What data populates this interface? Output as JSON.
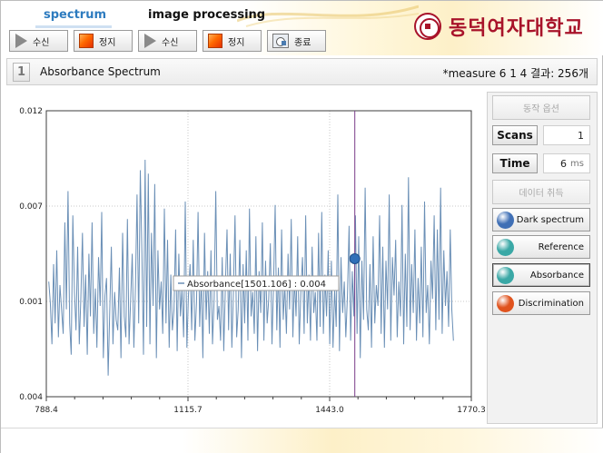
{
  "header": {
    "tabs": [
      "spectrum",
      "image processing"
    ],
    "toolbar": [
      {
        "label": "수신",
        "icon": "play-icon"
      },
      {
        "label": "정지",
        "icon": "stop-icon"
      },
      {
        "label": "수신",
        "icon": "play-icon"
      },
      {
        "label": "정지",
        "icon": "stop-icon"
      },
      {
        "label": "종료",
        "icon": "exit-icon"
      }
    ],
    "logo_text": "동덕여자대학교"
  },
  "titlebar": {
    "number": "1",
    "title": "Absorbance Spectrum",
    "measure": "*measure 6 1 4 결과: 256개"
  },
  "panel": {
    "options_label": "동작 옵션",
    "scans_label": "Scans",
    "scans_value": "1",
    "time_label": "Time",
    "time_value": "6",
    "time_unit": "ms",
    "cancel_label": "데이터 취득",
    "controls": [
      {
        "label": "Dark spectrum",
        "color": "#3f6fb5",
        "selected": false
      },
      {
        "label": "Reference",
        "color": "#3aa8a6",
        "selected": false
      },
      {
        "label": "Absorbance",
        "color": "#3aa8a6",
        "selected": true
      },
      {
        "label": "Discrimination",
        "color": "#e0531e",
        "selected": false
      }
    ]
  },
  "chart_data": {
    "type": "line",
    "xlim": [
      788.4,
      1770.3
    ],
    "ylim": [
      0.004,
      0.012
    ],
    "x_ticks": [
      "788.4",
      "1115.7",
      "1443.0",
      "1770.3"
    ],
    "y_ticks": [
      "0.012",
      "0.007",
      "0.001",
      "0.004"
    ],
    "line_color": "#6a8fb6",
    "cursor_x": 1501.106,
    "cursor_y": 0.004,
    "tooltip": "Absorbance[1501.106] : 0.004",
    "series": [
      {
        "name": "Absorbance",
        "x_start": 794,
        "x_end": 1729,
        "values": [
          0.0053,
          0.0047,
          0.0035,
          0.0058,
          0.0041,
          0.0062,
          0.0037,
          0.0052,
          0.0045,
          0.0038,
          0.007,
          0.0045,
          0.0079,
          0.0041,
          0.0032,
          0.0072,
          0.005,
          0.0039,
          0.0063,
          0.0035,
          0.0048,
          0.0067,
          0.004,
          0.0055,
          0.0032,
          0.0061,
          0.0043,
          0.007,
          0.0038,
          0.0051,
          0.0034,
          0.006,
          0.0046,
          0.0073,
          0.0031,
          0.0049,
          0.0054,
          0.0026,
          0.0045,
          0.0063,
          0.0035,
          0.005,
          0.0042,
          0.0039,
          0.0057,
          0.0031,
          0.0067,
          0.0043,
          0.0037,
          0.0071,
          0.0035,
          0.0048,
          0.0061,
          0.0034,
          0.0052,
          0.0078,
          0.0041,
          0.0085,
          0.0062,
          0.0032,
          0.0088,
          0.004,
          0.0084,
          0.0035,
          0.0067,
          0.0046,
          0.0081,
          0.0031,
          0.0062,
          0.0045,
          0.0053,
          0.0038,
          0.0074,
          0.0041,
          0.0065,
          0.0034,
          0.0055,
          0.0039,
          0.0045,
          0.0068,
          0.0033,
          0.0061,
          0.0043,
          0.0051,
          0.0037,
          0.0076,
          0.0034,
          0.0049,
          0.0058,
          0.0039,
          0.0065,
          0.0036,
          0.0047,
          0.0073,
          0.004,
          0.0054,
          0.0031,
          0.0067,
          0.0042,
          0.0056,
          0.0038,
          0.0062,
          0.0035,
          0.0048,
          0.0079,
          0.0042,
          0.0046,
          0.0036,
          0.006,
          0.0033,
          0.0052,
          0.0068,
          0.0039,
          0.0061,
          0.0034,
          0.005,
          0.0072,
          0.0037,
          0.0045,
          0.0065,
          0.0031,
          0.0058,
          0.0041,
          0.0062,
          0.0036,
          0.0074,
          0.0043,
          0.005,
          0.0038,
          0.0066,
          0.0033,
          0.0056,
          0.0044,
          0.007,
          0.0036,
          0.0059,
          0.0041,
          0.0048,
          0.0064,
          0.0035,
          0.0053,
          0.0075,
          0.0039,
          0.0057,
          0.0034,
          0.0068,
          0.0042,
          0.0052,
          0.0038,
          0.0061,
          0.0045,
          0.0071,
          0.0037,
          0.0054,
          0.0043,
          0.0066,
          0.0035,
          0.005,
          0.006,
          0.0038,
          0.0072,
          0.0041,
          0.0055,
          0.0036,
          0.0063,
          0.0044,
          0.005,
          0.0036,
          0.0067,
          0.004,
          0.0073,
          0.0038,
          0.0055,
          0.0043,
          0.0062,
          0.0035,
          0.0059,
          0.0034,
          0.0051,
          0.004,
          0.0078,
          0.0033,
          0.006,
          0.0044,
          0.0053,
          0.0037,
          0.0049,
          0.0069,
          0.0036,
          0.0056,
          0.0043,
          0.0072,
          0.0038,
          0.0066,
          0.0031,
          0.0059,
          0.0042,
          0.008,
          0.0045,
          0.0039,
          0.0058,
          0.0034,
          0.0066,
          0.0041,
          0.0052,
          0.0046,
          0.0072,
          0.0038,
          0.0063,
          0.0034,
          0.0059,
          0.0045,
          0.0078,
          0.0036,
          0.006,
          0.0049,
          0.0065,
          0.0037,
          0.0053,
          0.0043,
          0.0075,
          0.0035,
          0.0061,
          0.004,
          0.0083,
          0.0039,
          0.0058,
          0.0044,
          0.0068,
          0.0036,
          0.0054,
          0.0041,
          0.0063,
          0.0037,
          0.0076,
          0.0044,
          0.0052,
          0.0035,
          0.0059,
          0.0048,
          0.0072,
          0.0039,
          0.0068,
          0.0042,
          0.008,
          0.0038,
          0.0062,
          0.0046,
          0.0056,
          0.004,
          0.0068,
          0.0045,
          0.0036
        ]
      }
    ]
  }
}
